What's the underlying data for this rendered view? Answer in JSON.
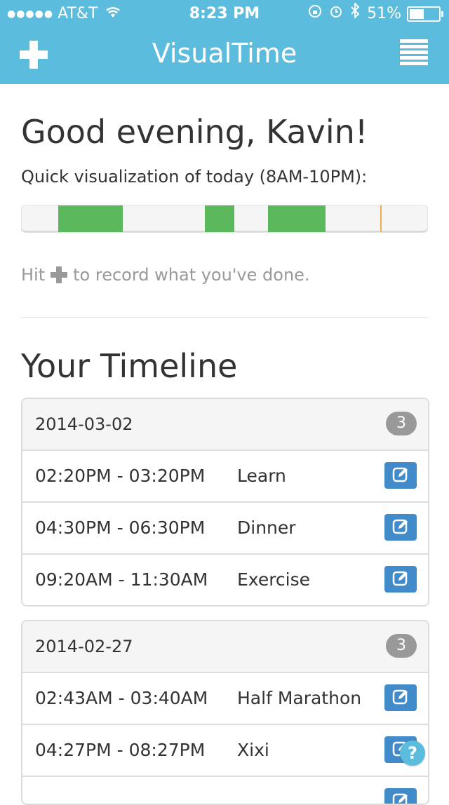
{
  "status_bar": {
    "carrier": "AT&T",
    "time": "8:23 PM",
    "battery": "51%",
    "battery_level": 0.51
  },
  "nav": {
    "title": "VisualTime"
  },
  "greeting": "Good evening, Kavin!",
  "quick_viz": {
    "label": "Quick visualization of today (8AM-10PM):",
    "range_start_hour": 8,
    "range_end_hour": 22,
    "segments": [
      {
        "start_hour": 9.27,
        "end_hour": 11.5,
        "label": "Exercise"
      },
      {
        "start_hour": 14.33,
        "end_hour": 15.33,
        "label": "Learn"
      },
      {
        "start_hour": 16.5,
        "end_hour": 18.5,
        "label": "Dinner"
      }
    ],
    "now_hour": 20.38,
    "segment_color": "#5cb85c",
    "now_color": "#f0ad4e"
  },
  "hint": {
    "before": "Hit",
    "after": "to record what you've done."
  },
  "timeline": {
    "title": "Your Timeline",
    "groups": [
      {
        "date": "2014-03-02",
        "count": "3",
        "entries": [
          {
            "time": "02:20PM - 03:20PM",
            "activity": "Learn"
          },
          {
            "time": "04:30PM - 06:30PM",
            "activity": "Dinner"
          },
          {
            "time": "09:20AM - 11:30AM",
            "activity": "Exercise"
          }
        ]
      },
      {
        "date": "2014-02-27",
        "count": "3",
        "entries": [
          {
            "time": "02:43AM - 03:40AM",
            "activity": "Half Marathon"
          },
          {
            "time": "04:27PM - 08:27PM",
            "activity": "Xixi"
          },
          {
            "time": "",
            "activity": ""
          }
        ]
      }
    ]
  },
  "colors": {
    "brand": "#5bbcdd",
    "edit_button": "#428bca",
    "badge": "#999999"
  },
  "icons": {
    "add": "plus-icon",
    "menu": "hamburger-menu-icon",
    "edit": "edit-icon",
    "help": "help-icon"
  },
  "help_label": "?"
}
